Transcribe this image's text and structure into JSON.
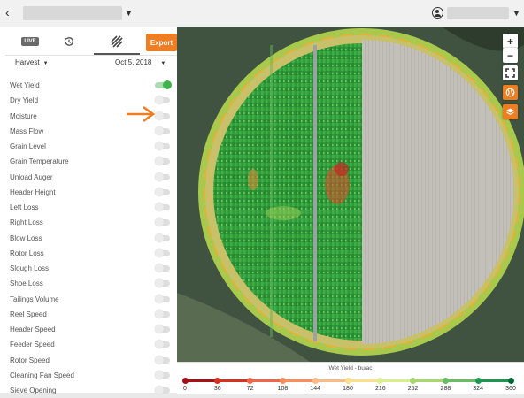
{
  "header": {
    "back_icon": "chevron-left-icon",
    "user_icon": "user-circle-icon"
  },
  "panel": {
    "tabs": {
      "live_label": "LIVE",
      "history_icon": "history-icon",
      "layers_icon": "striped-layers-icon"
    },
    "export_label": "Export",
    "operation": "Harvest",
    "date": "Oct 5, 2018",
    "layers": [
      {
        "label": "Wet Yield",
        "on": true
      },
      {
        "label": "Dry Yield",
        "on": false
      },
      {
        "label": "Moisture",
        "on": false
      },
      {
        "label": "Mass Flow",
        "on": false
      },
      {
        "label": "Grain Level",
        "on": false
      },
      {
        "label": "Grain Temperature",
        "on": false
      },
      {
        "label": "Unload Auger",
        "on": false
      },
      {
        "label": "Header Height",
        "on": false
      },
      {
        "label": "Left Loss",
        "on": false
      },
      {
        "label": "Right Loss",
        "on": false
      },
      {
        "label": "Blow Loss",
        "on": false
      },
      {
        "label": "Rotor Loss",
        "on": false
      },
      {
        "label": "Slough Loss",
        "on": false
      },
      {
        "label": "Shoe Loss",
        "on": false
      },
      {
        "label": "Tailings Volume",
        "on": false
      },
      {
        "label": "Reel Speed",
        "on": false
      },
      {
        "label": "Header Speed",
        "on": false
      },
      {
        "label": "Feeder Speed",
        "on": false
      },
      {
        "label": "Rotor Speed",
        "on": false
      },
      {
        "label": "Cleaning Fan Speed",
        "on": false
      },
      {
        "label": "Sieve Opening",
        "on": false
      }
    ]
  },
  "map_controls": {
    "zoom_in": "+",
    "zoom_out": "−",
    "fullscreen_icon": "fullscreen-icon",
    "globe_icon": "globe-icon",
    "layers_icon": "layers-icon"
  },
  "legend": {
    "title": "Wet Yield - bu/ac",
    "ticks": [
      "0",
      "36",
      "72",
      "108",
      "144",
      "180",
      "216",
      "252",
      "288",
      "324",
      "360"
    ],
    "tick_colors": [
      "#a50f15",
      "#d7301f",
      "#ef6548",
      "#fc8d59",
      "#fdbb84",
      "#fee08b",
      "#d9ef8b",
      "#a6d96a",
      "#66bd63",
      "#1a9850",
      "#006837"
    ]
  },
  "colors": {
    "accent": "#ef7d22",
    "toggle_on": "#3db54a"
  }
}
